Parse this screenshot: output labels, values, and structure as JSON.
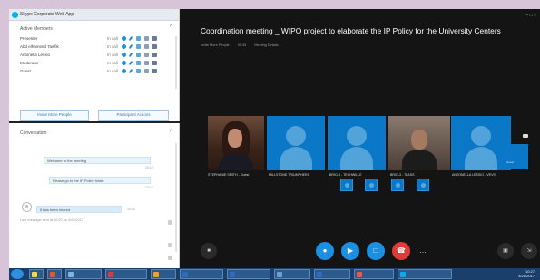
{
  "window": {
    "title": "Skype Corporate Web App"
  },
  "participants": {
    "section_title": "Active Members",
    "rows": [
      {
        "name": "Presenter",
        "status": "In call"
      },
      {
        "name": "Abd elhameed Tawfik",
        "status": "In call"
      },
      {
        "name": "Antonella Lessio",
        "status": "In call"
      },
      {
        "name": "Moderator",
        "status": "In call"
      },
      {
        "name": "Guest",
        "status": "In call"
      }
    ],
    "invite_label": "Invite More People",
    "settings_label": "Participant Actions"
  },
  "conversation": {
    "title": "Conversation",
    "messages": [
      {
        "text": "Welcome to the meeting",
        "meta": "10:14"
      },
      {
        "text": "Please go to the IP Policy folder",
        "meta": "10:16"
      },
      {
        "text": "It has been shared",
        "meta": "10:20"
      }
    ],
    "footer": "Last message sent at 10:20 on 4/28/2017"
  },
  "meeting": {
    "title": "Coordination meeting _ WIPO project to elaborate the IP Policy for the University Centers",
    "submeta": [
      "Invite More People",
      "00:45",
      "Meeting Details"
    ],
    "tiles": [
      {
        "label": "STEPHANIE SMITH - Guest"
      },
      {
        "label": "MILLSTONE TRIUMPHERS"
      },
      {
        "label": "BRIO-3 - TECHWILLE"
      },
      {
        "label": "BRIO-3 - TLASS"
      },
      {
        "label": "ANTONELLA LESSIO - VEVS"
      }
    ],
    "mini_tile_label": "Guest"
  },
  "taskbar": {
    "time": "10:27",
    "date": "4/28/2017"
  },
  "colors": {
    "accent": "#0a78c6",
    "hangup": "#e03a3a",
    "video_bg": "#141414"
  }
}
